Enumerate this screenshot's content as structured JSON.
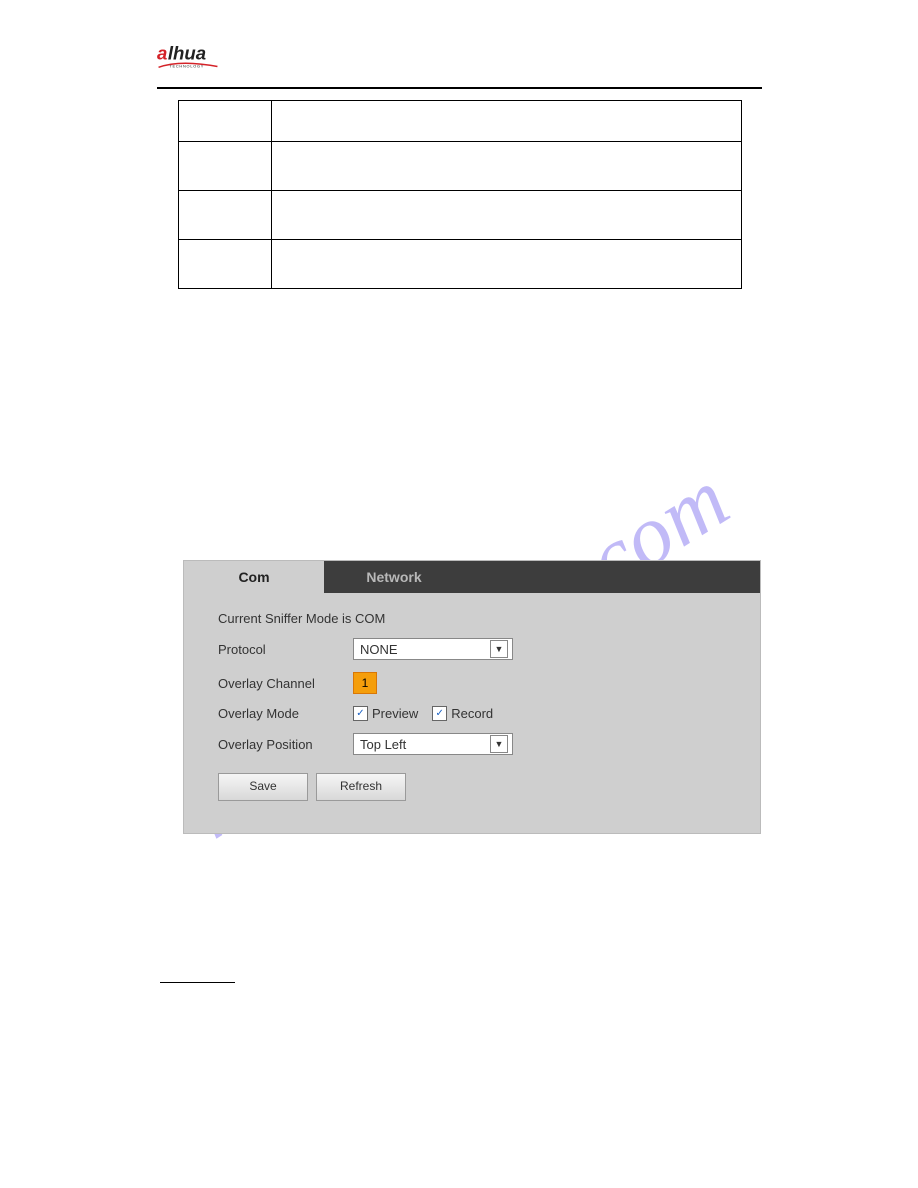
{
  "watermark_text": "manualshive.com",
  "ui": {
    "tabs": {
      "com": "Com",
      "network": "Network"
    },
    "sniffer_line": "Current Sniffer Mode is COM",
    "labels": {
      "protocol": "Protocol",
      "overlay_channel": "Overlay Channel",
      "overlay_mode": "Overlay Mode",
      "overlay_position": "Overlay Position"
    },
    "protocol_value": "NONE",
    "channel_value": "1",
    "mode_preview": "Preview",
    "mode_record": "Record",
    "position_value": "Top Left",
    "buttons": {
      "save": "Save",
      "refresh": "Refresh"
    }
  }
}
